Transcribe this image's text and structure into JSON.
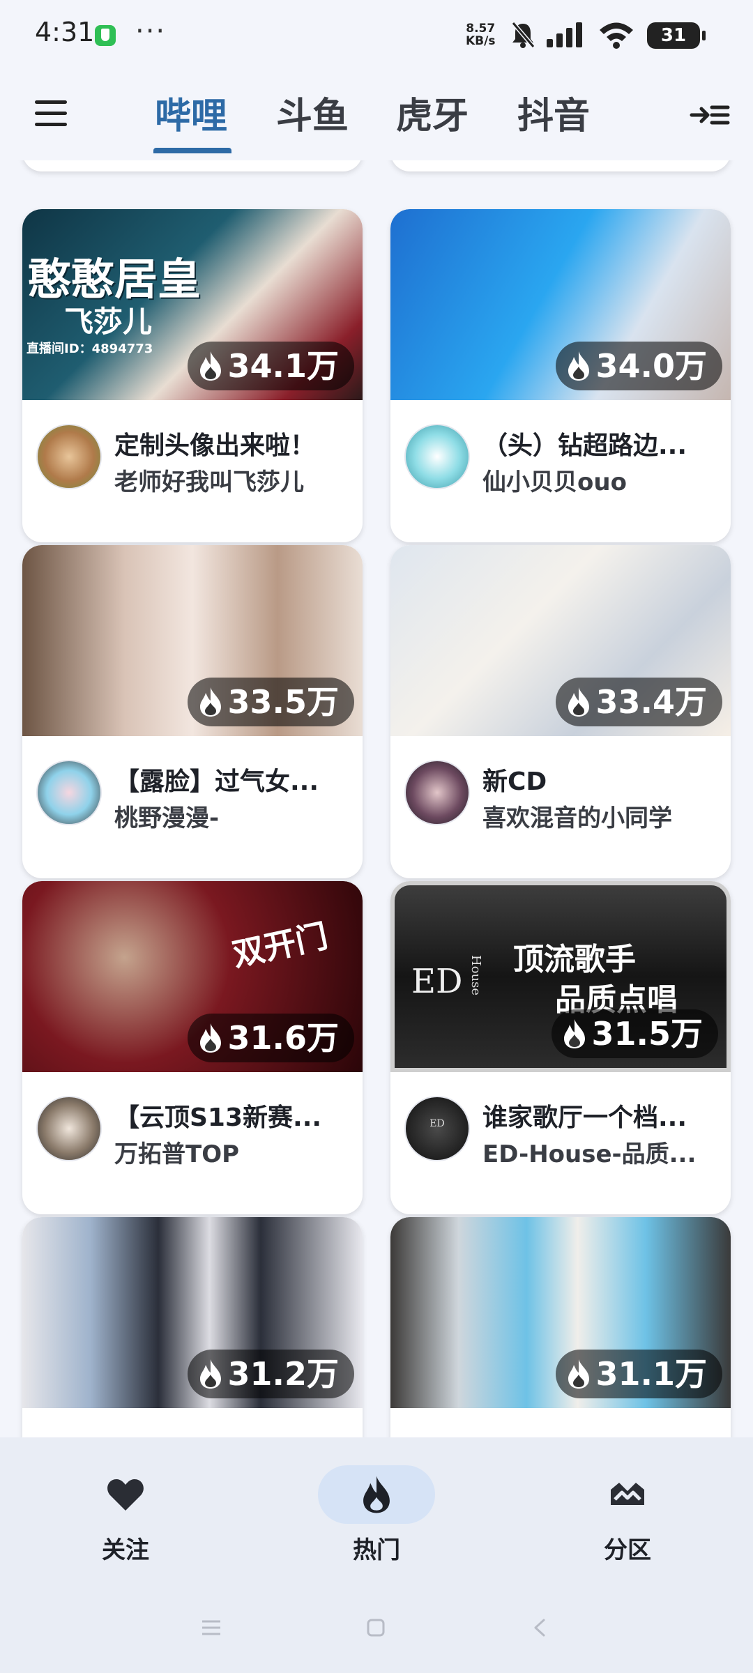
{
  "status_bar": {
    "time": "4:31",
    "more": "···",
    "speed_value": "8.57",
    "speed_unit": "KB/s",
    "battery": "31"
  },
  "top_nav": {
    "tabs": [
      {
        "label": "哔哩",
        "active": true
      },
      {
        "label": "斗鱼",
        "active": false
      },
      {
        "label": "虎牙",
        "active": false
      },
      {
        "label": "抖音",
        "active": false
      }
    ],
    "accent_color": "#2d6aa6"
  },
  "cards": [
    {
      "views": "34.1万",
      "title": "定制头像出来啦！",
      "owner": "老师好我叫飞莎儿",
      "thumb_text": "憨憨居皇",
      "thumb_sub": "飞莎儿",
      "thumb_id": "直播间ID：4894773"
    },
    {
      "views": "34.0万",
      "title": "（头）钻超路边...",
      "owner": "仙小贝贝ouo"
    },
    {
      "views": "33.5万",
      "title": "【露脸】过气女...",
      "owner": "桃野漫漫-"
    },
    {
      "views": "33.4万",
      "title": "新CD",
      "owner": "喜欢混音的小同学"
    },
    {
      "views": "31.6万",
      "title": "【云顶S13新赛...",
      "owner": "万拓普TOP",
      "thumb_text": "双开门"
    },
    {
      "views": "31.5万",
      "title": "谁家歌厅一个档...",
      "owner": "ED-House-品质...",
      "thumb_text": "顶流歌手",
      "thumb_sub": "品质点唱",
      "thumb_logo": "ED",
      "thumb_logo_sub": "House"
    },
    {
      "views": "31.2万",
      "title": "",
      "owner": ""
    },
    {
      "views": "31.1万",
      "title": "",
      "owner": ""
    }
  ],
  "bottom_nav": {
    "items": [
      {
        "label": "关注",
        "icon": "heart-icon"
      },
      {
        "label": "热门",
        "icon": "flame-icon",
        "active": true
      },
      {
        "label": "分区",
        "icon": "category-icon"
      }
    ]
  }
}
